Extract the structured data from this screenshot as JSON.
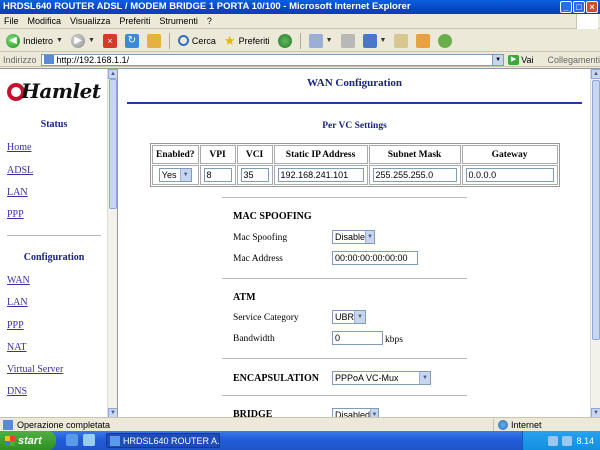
{
  "window": {
    "title": "HRDSL640 ROUTER ADSL / MODEM BRIDGE 1 PORTA 10/100 - Microsoft Internet Explorer"
  },
  "menu": [
    "File",
    "Modifica",
    "Visualizza",
    "Preferiti",
    "Strumenti",
    "?"
  ],
  "toolbar": {
    "back_label": "Indietro",
    "search_label": "Cerca",
    "favorites_label": "Preferiti"
  },
  "address": {
    "label": "Indirizzo",
    "url": "http://192.168.1.1/",
    "go_label": "Vai",
    "links_label": "Collegamenti"
  },
  "sidebar": {
    "logo_text": "Hamlet",
    "status_heading": "Status",
    "status_items": [
      "Home",
      "ADSL",
      "LAN",
      "PPP"
    ],
    "config_heading": "Configuration",
    "config_items": [
      "WAN",
      "LAN",
      "PPP",
      "NAT",
      "Virtual Server",
      "DNS"
    ]
  },
  "main": {
    "title": "WAN Configuration",
    "vc_title": "Per VC Settings",
    "vc_headers": [
      "Enabled?",
      "VPI",
      "VCI",
      "Static IP Address",
      "Subnet Mask",
      "Gateway"
    ],
    "vc_row": {
      "enabled": "Yes",
      "vpi": "8",
      "vci": "35",
      "ip": "192.168.241.101",
      "mask": "255.255.255.0",
      "gateway": "0.0.0.0"
    },
    "mac_heading": "MAC SPOOFING",
    "mac_spoofing_label": "Mac Spoofing",
    "mac_spoofing_value": "Disable",
    "mac_address_label": "Mac Address",
    "mac_address_value": "00:00:00:00:00:00",
    "atm_heading": "ATM",
    "service_category_label": "Service Category",
    "service_category_value": "UBR",
    "bandwidth_label": "Bandwidth",
    "bandwidth_value": "0",
    "bandwidth_unit": "kbps",
    "encap_heading": "ENCAPSULATION",
    "encap_value": "PPPoA VC-Mux",
    "bridge_heading": "BRIDGE",
    "bridge_value": "Disabled"
  },
  "statusbar": {
    "text": "Operazione completata",
    "zone": "Internet"
  },
  "taskbar": {
    "start_label": "start",
    "task_label": "HRDSL640 ROUTER A...",
    "clock": "8.14"
  }
}
